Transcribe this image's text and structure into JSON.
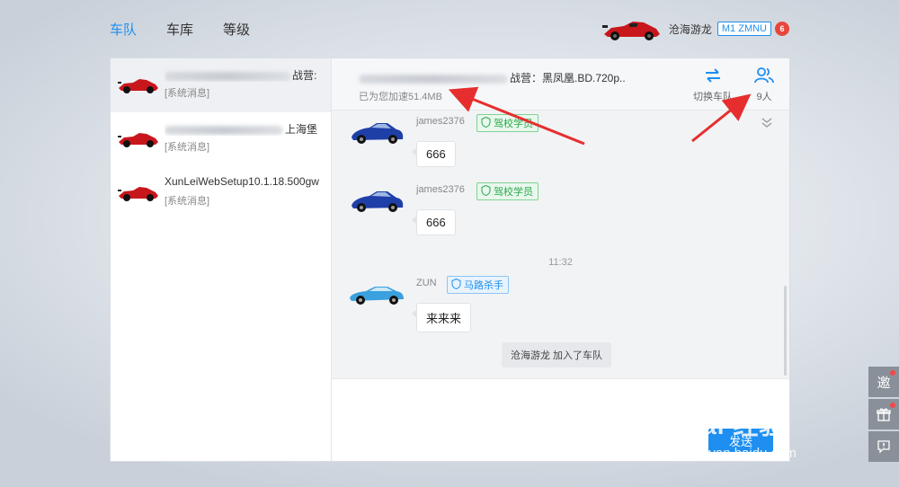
{
  "nav": {
    "tabs": [
      {
        "label": "车队",
        "active": true
      },
      {
        "label": "车库",
        "active": false
      },
      {
        "label": "等级",
        "active": false
      }
    ]
  },
  "user": {
    "name": "沧海游龙",
    "tag": "M1 ZMNU",
    "badge": "6"
  },
  "conversations": [
    {
      "title_suffix": "战营:",
      "sub": "[系统消息]",
      "active": true
    },
    {
      "title_suffix": "上海堡",
      "sub": "[系统消息]",
      "active": false
    },
    {
      "title_suffix": "XunLeiWebSetup10.1.18.500gw",
      "sub": "[系统消息]",
      "active": false
    }
  ],
  "chat_header": {
    "title_suffix": "战营：黑凤凰.BD.720p..",
    "speedup": "已为您加速51.4MB",
    "switch_label": "切换车队",
    "members_label": "9人"
  },
  "messages": [
    {
      "name": "james2376",
      "rank": "驾校学员",
      "text": "666"
    },
    {
      "name": "james2376",
      "rank": "驾校学员",
      "text": "666"
    },
    {
      "name": "ZUN",
      "rank": "马路杀手",
      "text": "来来来"
    }
  ],
  "time_separator": "11:32",
  "notice": "沧海游龙 加入了车队",
  "send_label": "发送",
  "side_tools": {
    "invite": "邀",
    "gift_icon": "gift-icon",
    "feedback_icon": "feedback-icon"
  },
  "watermark": {
    "main": "Bai 经验",
    "sub": "jingyan.baidu.com"
  },
  "colors": {
    "accent": "#1e8ff0",
    "rank_green": "#2aa84a",
    "arrow_red": "#e62e2e"
  }
}
